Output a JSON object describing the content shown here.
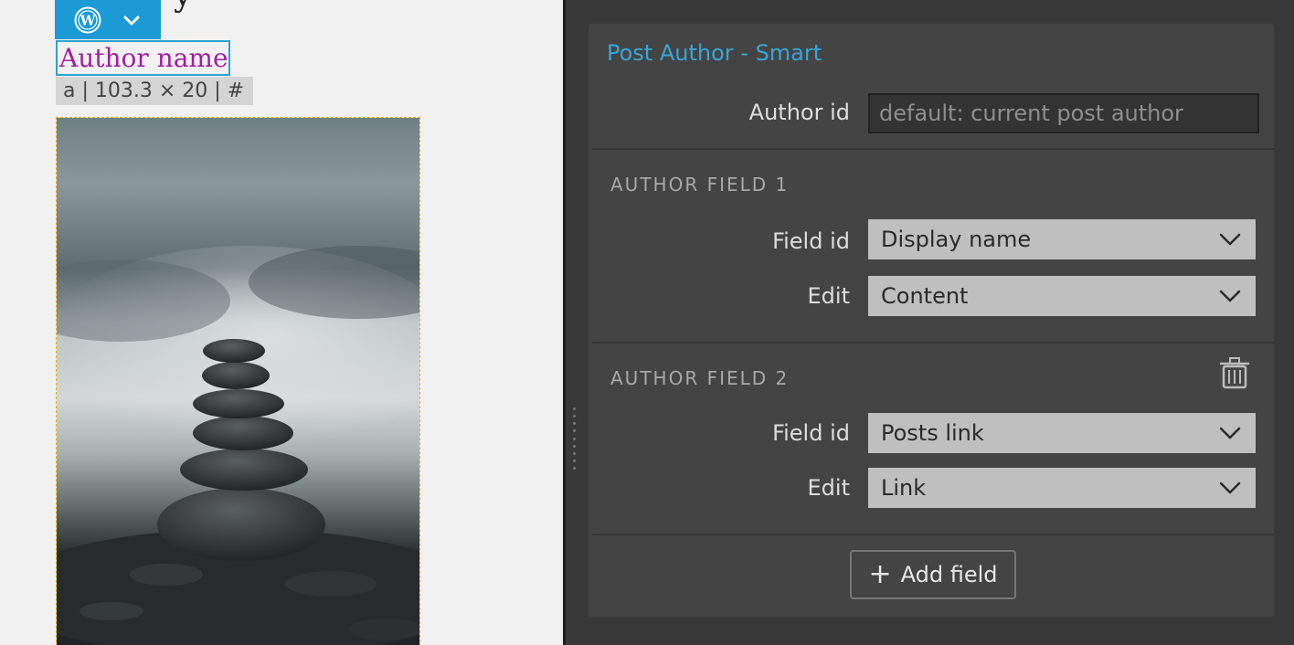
{
  "canvas": {
    "heading_fragment": "y",
    "author_link_text": "Author name",
    "element_info": "a | 103.3 × 20 | #",
    "toolbar_icons": [
      "wordpress-icon",
      "chevron-down-icon"
    ]
  },
  "panel": {
    "title": "Post Author - Smart",
    "author_id": {
      "label": "Author id",
      "placeholder": "default: current post author",
      "value": ""
    },
    "fields": [
      {
        "section_title": "AUTHOR FIELD 1",
        "field_id_label": "Field id",
        "field_id_value": "Display name",
        "edit_label": "Edit",
        "edit_value": "Content"
      },
      {
        "section_title": "AUTHOR FIELD 2",
        "field_id_label": "Field id",
        "field_id_value": "Posts link",
        "edit_label": "Edit",
        "edit_value": "Link",
        "delete_icon": "trash-icon"
      }
    ],
    "add_button": {
      "icon": "plus-icon",
      "label": "Add field"
    }
  },
  "colors": {
    "accent": "#37a6d8",
    "wp_blue": "#1b9ad6",
    "link": "#a020a0",
    "panel_bg": "#444444",
    "select_bg": "#bfbfbf"
  }
}
